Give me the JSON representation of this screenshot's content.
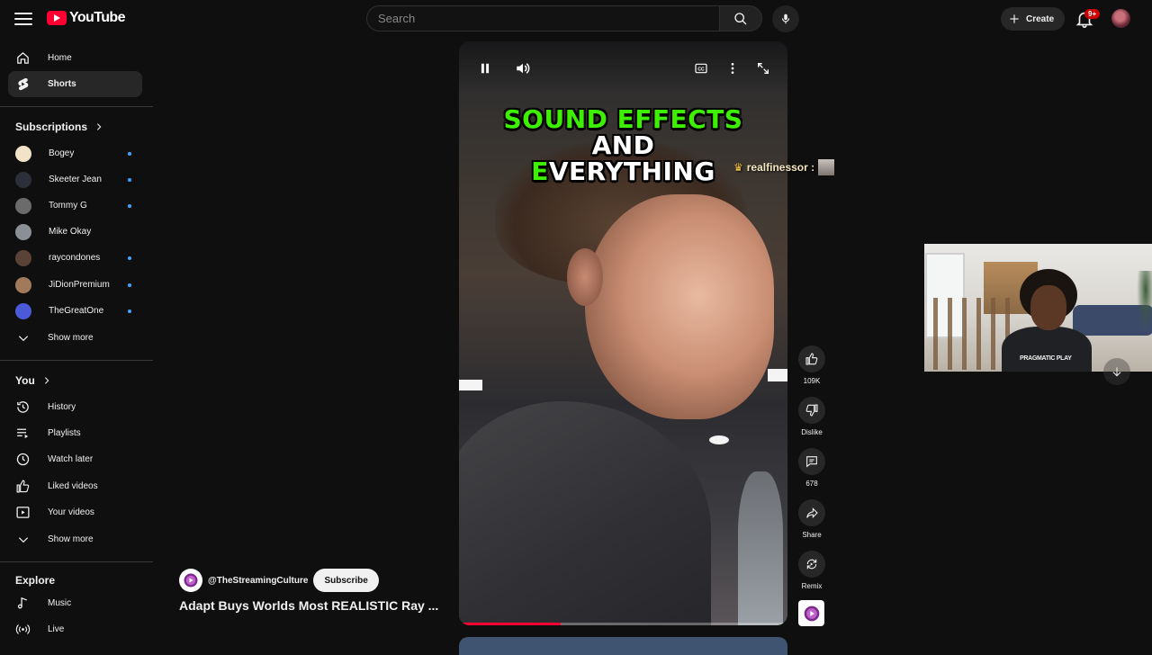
{
  "header": {
    "logo_text": "YouTube",
    "search_placeholder": "Search",
    "create_label": "Create",
    "notification_badge": "9+"
  },
  "sidebar": {
    "main": [
      {
        "label": "Home",
        "icon": "home-icon"
      },
      {
        "label": "Shorts",
        "icon": "shorts-icon",
        "active": true
      }
    ],
    "subscriptions_title": "Subscriptions",
    "subscriptions": [
      {
        "label": "Bogey",
        "color": "#f2e2c8",
        "new": true
      },
      {
        "label": "Skeeter Jean",
        "color": "#2b2f3a",
        "new": true
      },
      {
        "label": "Tommy G",
        "color": "#6b6b6b",
        "new": true
      },
      {
        "label": "Mike Okay",
        "color": "#8b8f96",
        "new": false
      },
      {
        "label": "raycondones",
        "color": "#5a4236",
        "new": true
      },
      {
        "label": "JiDionPremium",
        "color": "#a07a5a",
        "new": true
      },
      {
        "label": "TheGreatOne",
        "color": "#4a5ad8",
        "new": true
      }
    ],
    "subs_show_more": "Show more",
    "you_title": "You",
    "you_items": [
      {
        "label": "History",
        "icon": "history-icon"
      },
      {
        "label": "Playlists",
        "icon": "playlists-icon"
      },
      {
        "label": "Watch later",
        "icon": "watch-later-icon"
      },
      {
        "label": "Liked videos",
        "icon": "liked-icon"
      },
      {
        "label": "Your videos",
        "icon": "your-videos-icon"
      }
    ],
    "you_show_more": "Show more",
    "explore_title": "Explore",
    "explore_items": [
      {
        "label": "Music",
        "icon": "music-icon"
      },
      {
        "label": "Live",
        "icon": "live-icon"
      }
    ]
  },
  "short": {
    "caption_line1": "SOUND EFFECTS",
    "caption_line2": "AND",
    "caption_line3_first": "E",
    "caption_line3_rest": "VERYTHING",
    "overlay_username": "realfinessor :",
    "progress_fraction": 0.31,
    "channel": "@TheStreamingCulture",
    "subscribe_label": "Subscribe",
    "title": "Adapt Buys Worlds Most REALISTIC Ray ..."
  },
  "actions": {
    "like_count": "109K",
    "dislike_label": "Dislike",
    "comment_count": "678",
    "share_label": "Share",
    "remix_label": "Remix"
  },
  "webcam": {
    "shirt_text": "PRAGMATIC PLAY"
  }
}
